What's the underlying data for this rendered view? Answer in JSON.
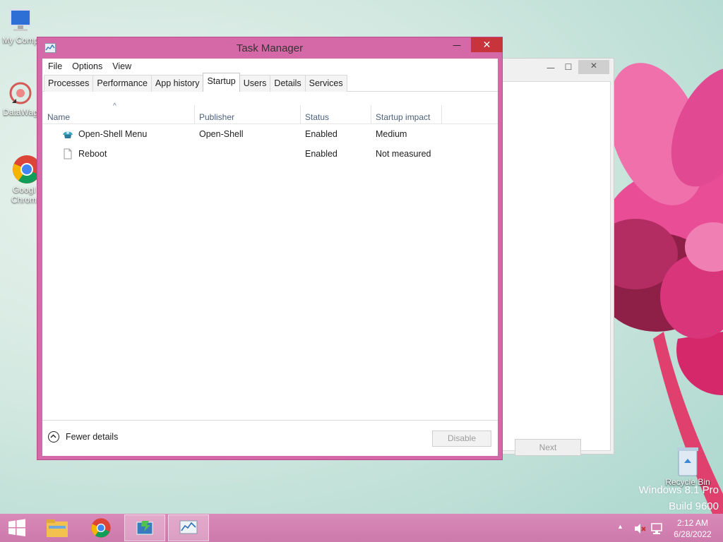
{
  "desktop": {
    "icons": [
      {
        "label_lines": [
          "My Comp"
        ],
        "icon": "computer-icon"
      },
      {
        "label_lines": [
          "DataWag"
        ],
        "icon": "datawag-icon"
      },
      {
        "label_lines": [
          "Googl",
          "Chrom"
        ],
        "icon": "chrome-icon"
      },
      {
        "label_lines": [
          "Recycle Bin"
        ],
        "icon": "recycle-bin-icon"
      }
    ],
    "watermark": {
      "line1": "Windows 8.1 Pro",
      "line2": "Build 9600"
    }
  },
  "bg_dialog": {
    "next_label": "Next",
    "min_glyph": "—",
    "max_glyph": "☐",
    "close_glyph": "✕"
  },
  "window": {
    "title": "Task Manager",
    "min_glyph": "—",
    "max_glyph": "☐",
    "close_glyph": "✕",
    "menu": [
      "File",
      "Options",
      "View"
    ],
    "tabs": [
      "Processes",
      "Performance",
      "App history",
      "Startup",
      "Users",
      "Details",
      "Services"
    ],
    "active_tab": "Startup",
    "columns": {
      "name": "Name",
      "publisher": "Publisher",
      "status": "Status",
      "impact": "Startup impact"
    },
    "rows": [
      {
        "name": "Open-Shell Menu",
        "publisher": "Open-Shell",
        "status": "Enabled",
        "impact": "Medium",
        "icon": "open-shell-icon"
      },
      {
        "name": "Reboot",
        "publisher": "",
        "status": "Enabled",
        "impact": "Not measured",
        "icon": "file-icon"
      }
    ],
    "footer": {
      "fewer_details": "Fewer details",
      "disable": "Disable"
    }
  },
  "taskbar": {
    "items": [
      "start-icon",
      "file-explorer-icon",
      "chrome-icon",
      "open-shell-setup-icon",
      "task-manager-icon"
    ],
    "clock": {
      "time": "2:12 AM",
      "date": "6/28/2022"
    }
  },
  "colors": {
    "accent": "#d569a8",
    "close": "#c7343b"
  }
}
